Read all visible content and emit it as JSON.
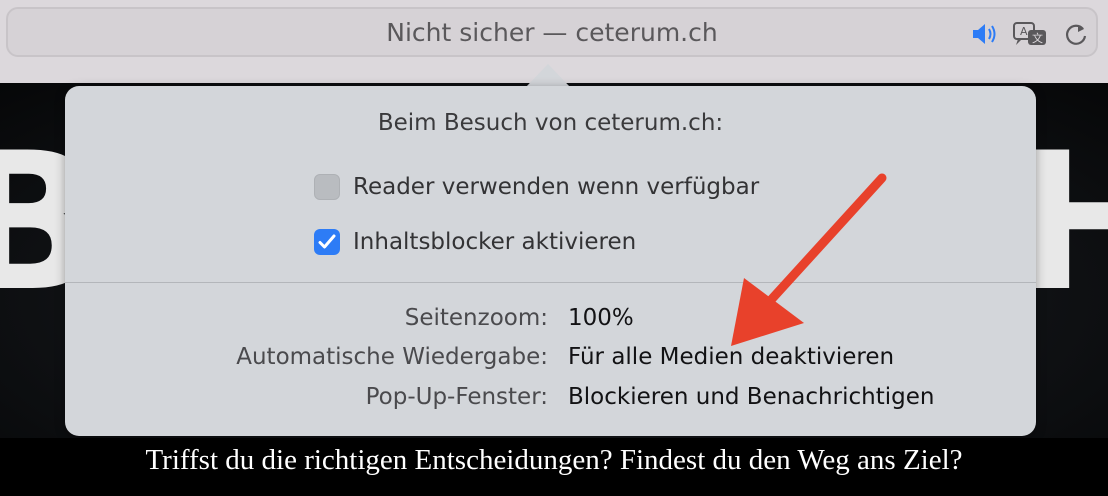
{
  "toolbar": {
    "address": "Nicht sicher — ceterum.ch",
    "icons": [
      "speaker-icon",
      "translate-icon",
      "reload-icon"
    ],
    "accent": "#2d7cf6"
  },
  "page": {
    "letter_left": "B",
    "letter_right": "H",
    "subtitle": "Triffst du die richtigen Entscheidungen? Findest du den Weg ans Ziel?"
  },
  "popover": {
    "title": "Beim Besuch von ceterum.ch:",
    "options": [
      {
        "label": "Reader verwenden wenn verfügbar",
        "checked": false
      },
      {
        "label": "Inhaltsblocker aktivieren",
        "checked": true
      }
    ],
    "settings": [
      {
        "label": "Seitenzoom:",
        "value": "100%"
      },
      {
        "label": "Automatische Wiedergabe:",
        "value": "Für alle Medien deaktivieren"
      },
      {
        "label": "Pop-Up-Fenster:",
        "value": "Blockieren und Benachrichtigen"
      }
    ]
  },
  "annotation": {
    "color": "#e8412b"
  }
}
